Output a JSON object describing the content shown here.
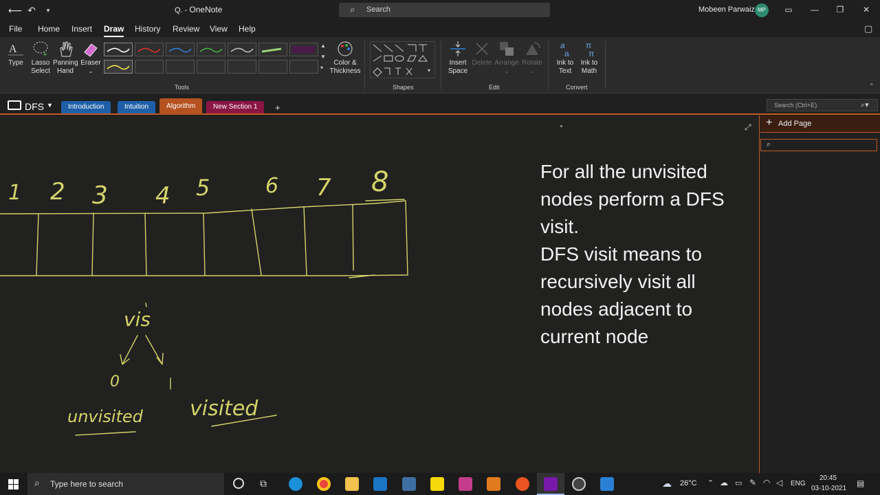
{
  "titlebar": {
    "app_title": "OneNote",
    "search_label": "Search",
    "user_name": "Mobeen Parwaiz",
    "user_initials": "MP"
  },
  "menu": {
    "tabs": [
      "File",
      "Home",
      "Insert",
      "Draw",
      "History",
      "Review",
      "View",
      "Help"
    ],
    "active": "Draw"
  },
  "ribbon": {
    "type_label": "Type",
    "lasso_label_1": "Lasso",
    "lasso_label_2": "Select",
    "panning_label_1": "Panning",
    "panning_label_2": "Hand",
    "eraser_label": "Eraser",
    "color_label_1": "Color &",
    "color_label_2": "Thickness",
    "tools_group": "Tools",
    "shapes_group": "Shapes",
    "insert_space_1": "Insert",
    "insert_space_2": "Space",
    "delete_label": "Delete",
    "arrange_label": "Arrange",
    "rotate_label": "Rotate",
    "edit_group": "Edit",
    "ink_to_text_1": "Ink to",
    "ink_to_text_2": "Text",
    "ink_to_math_1": "Ink to",
    "ink_to_math_2": "Math",
    "convert_group": "Convert",
    "pen_colors": [
      "#ffffff",
      "#d9342b",
      "#2f7fd9",
      "#3fae3f",
      "#bdbdbd",
      "#9bd37a",
      "#7b2a7a",
      "#f2e34a"
    ]
  },
  "notebook": {
    "name": "DFS",
    "sections": [
      {
        "label": "Introduction",
        "color": "#1f5fa8"
      },
      {
        "label": "Intuition",
        "color": "#1f5fa8"
      },
      {
        "label": "Algorithm",
        "color": "#b5521f"
      },
      {
        "label": "New Section 1",
        "color": "#8a1646"
      }
    ],
    "active_section": "Algorithm",
    "search_placeholder": "Search (Ctrl+E)"
  },
  "page": {
    "note_lines": [
      "For all the unvisited",
      "nodes perform a DFS",
      "visit.",
      "DFS visit means to",
      "recursively visit all",
      "nodes adjacent to",
      "current node"
    ],
    "handwriting": {
      "digits": [
        "1",
        "2",
        "3",
        "4",
        "5",
        "6",
        "7",
        "8"
      ],
      "vis": "vis",
      "zero": "0",
      "one": "1",
      "unvisited": "unvisited",
      "visited": "visited"
    },
    "accent_color": "#c15a22",
    "ink_color": "#d4d46a"
  },
  "pages_panel": {
    "add_page_label": "Add Page"
  },
  "taskbar": {
    "search_placeholder": "Type here to search",
    "temperature": "26°C",
    "language": "ENG",
    "time": "20:45",
    "date": "03-10-2021"
  }
}
